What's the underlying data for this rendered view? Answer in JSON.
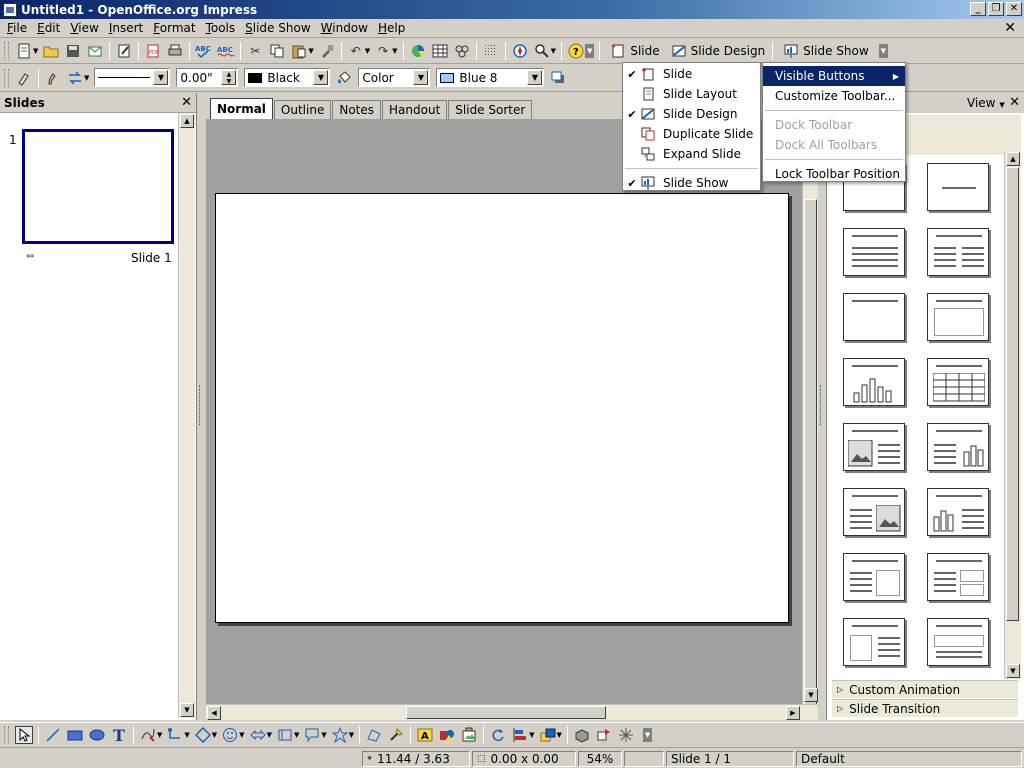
{
  "window": {
    "title": "Untitled1 - OpenOffice.org Impress"
  },
  "menubar": [
    "File",
    "Edit",
    "View",
    "Insert",
    "Format",
    "Tools",
    "Slide Show",
    "Window",
    "Help"
  ],
  "toolbar1": {
    "slide_label": "Slide",
    "slide_design_label": "Slide Design",
    "slide_show_label": "Slide Show"
  },
  "toolbar2": {
    "line_width": "0.00\"",
    "line_color": "Black",
    "area_style": "Color",
    "area_color": "Blue 8",
    "colors": {
      "line": "#000000",
      "area": "#99ccff"
    }
  },
  "slides_pane": {
    "title": "Slides",
    "slide_number": "1",
    "slide_label": "Slide 1"
  },
  "view_tabs": [
    "Normal",
    "Outline",
    "Notes",
    "Handout",
    "Slide Sorter"
  ],
  "tasks_pane": {
    "view_label": "View",
    "sections": [
      "Custom Animation",
      "Slide Transition"
    ]
  },
  "visible_buttons_menu": [
    {
      "label": "Slide",
      "checked": true,
      "icon": "new-slide-icon"
    },
    {
      "label": "Slide Layout",
      "checked": false,
      "icon": "slide-layout-icon"
    },
    {
      "label": "Slide Design",
      "checked": true,
      "icon": "slide-design-icon"
    },
    {
      "label": "Duplicate Slide",
      "checked": false,
      "icon": "duplicate-slide-icon"
    },
    {
      "label": "Expand Slide",
      "checked": false,
      "icon": "expand-slide-icon"
    },
    {
      "label": "Slide Show",
      "checked": true,
      "icon": "slide-show-icon"
    }
  ],
  "toolbar_context_menu": [
    {
      "label": "Visible Buttons",
      "highlighted": true,
      "disabled": false
    },
    {
      "label": "Customize Toolbar...",
      "highlighted": false,
      "disabled": false
    },
    {
      "label": "Dock Toolbar",
      "highlighted": false,
      "disabled": true
    },
    {
      "label": "Dock All Toolbars",
      "highlighted": false,
      "disabled": true
    },
    {
      "label": "Lock Toolbar Position",
      "highlighted": false,
      "disabled": false
    }
  ],
  "statusbar": {
    "position": "11.44 / 3.63",
    "size": "0.00 x 0.00",
    "zoom": "54%",
    "page": "Slide 1 / 1",
    "layout": "Default"
  },
  "colors": {
    "selection": "#0a246a",
    "thumb_border": "#00008b"
  }
}
